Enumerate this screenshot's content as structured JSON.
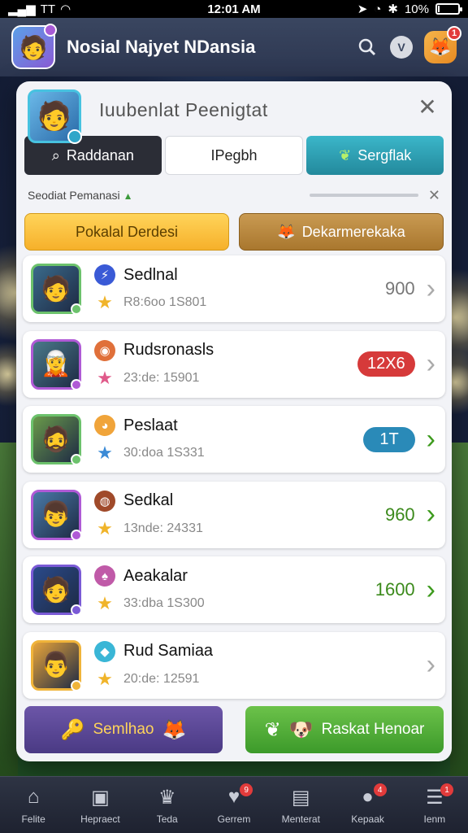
{
  "status_bar": {
    "carrier": "TT",
    "time": "12:01 AM",
    "battery": "10%",
    "battery_level": 0.1
  },
  "app_header": {
    "title": "Nosial Najyet NDansia"
  },
  "panel": {
    "title": "Iuubenlat Peenigtat",
    "segments": [
      {
        "label": "Raddanan",
        "style": "dark"
      },
      {
        "label": "IPegbh",
        "style": "white"
      },
      {
        "label": "Sergflak",
        "style": "teal"
      }
    ],
    "search_label": "Seodiat Pemanasi",
    "actions": {
      "left": "Pokalal Derdesi",
      "right": "Dekarmerekaka"
    },
    "rows": [
      {
        "name": "Sedlnal",
        "sub": "R8:6oo 1S801",
        "score": "900",
        "score_style": "plain",
        "chevron": "grey",
        "thumb_color": "#6cc26c",
        "thumb_bg": "#3a6a8a",
        "icon_color": "#3a5ad6"
      },
      {
        "name": "Rudsronasls",
        "sub": "23:de: 15901",
        "score": "12X6",
        "score_style": "red",
        "chevron": "grey",
        "thumb_color": "#b05ad6",
        "thumb_bg": "#4a7a8a",
        "icon_color": "#e0703a"
      },
      {
        "name": "Peslaat",
        "sub": "30:doa 1S331",
        "score": "1T",
        "score_style": "blue",
        "chevron": "green",
        "thumb_color": "#6cc26c",
        "thumb_bg": "#6a9a4a",
        "icon_color": "#f0a43a"
      },
      {
        "name": "Sedkal",
        "sub": "13nde: 24331",
        "score": "960",
        "score_style": "green",
        "chevron": "green",
        "thumb_color": "#b05ad6",
        "thumb_bg": "#4a7aa8",
        "icon_color": "#a04a2a"
      },
      {
        "name": "Aeakalar",
        "sub": "33:dba 1S300",
        "score": "1600",
        "score_style": "green",
        "chevron": "green",
        "thumb_color": "#7a5ad6",
        "thumb_bg": "#2a4a8a",
        "icon_color": "#c05aa8"
      },
      {
        "name": "Rud Samiaa",
        "sub": "20:de: 12591",
        "score": "",
        "score_style": "plain",
        "chevron": "grey",
        "thumb_color": "#f0b43a",
        "thumb_bg": "#e8a43a",
        "icon_color": "#3ab6d6"
      }
    ],
    "bottom_buttons": {
      "left": "Semlhao",
      "right": "Raskat Henoar"
    }
  },
  "tabbar": {
    "tabs": [
      {
        "label": "Felite",
        "icon": "home-icon",
        "badge": ""
      },
      {
        "label": "Hepraect",
        "icon": "calendar-icon",
        "badge": ""
      },
      {
        "label": "Teda",
        "icon": "trophy-icon",
        "badge": ""
      },
      {
        "label": "Gerrem",
        "icon": "heart-icon",
        "badge": "9"
      },
      {
        "label": "Menterat",
        "icon": "gift-icon",
        "badge": ""
      },
      {
        "label": "Kepaak",
        "icon": "chat-icon",
        "badge": "4"
      },
      {
        "label": "Ienm",
        "icon": "menu-icon",
        "badge": "1"
      }
    ]
  },
  "colors": {
    "accent_teal": "#3bb6c9",
    "accent_yellow": "#f6b02a",
    "accent_green": "#3c9a2a",
    "badge_red": "#e23b3b"
  }
}
